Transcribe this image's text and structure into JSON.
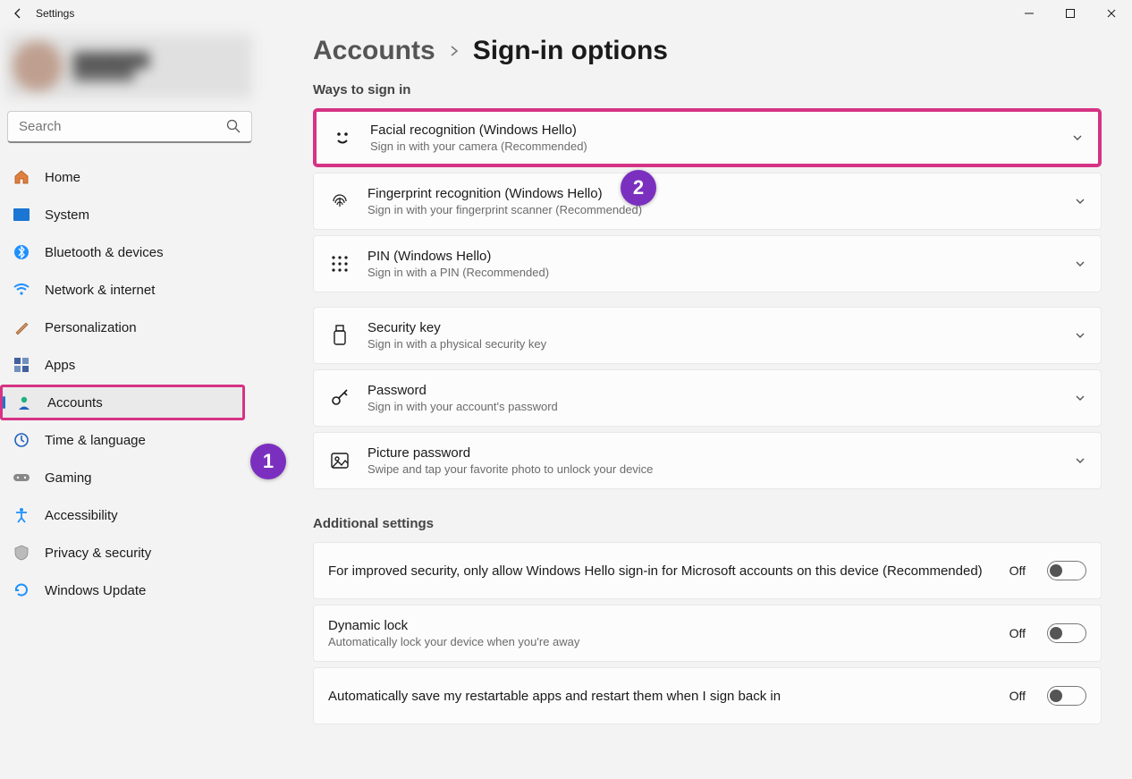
{
  "window": {
    "title": "Settings"
  },
  "search": {
    "placeholder": "Search"
  },
  "sidebar": {
    "items": [
      {
        "label": "Home",
        "icon": "home-icon"
      },
      {
        "label": "System",
        "icon": "system-icon"
      },
      {
        "label": "Bluetooth & devices",
        "icon": "bluetooth-icon"
      },
      {
        "label": "Network & internet",
        "icon": "wifi-icon"
      },
      {
        "label": "Personalization",
        "icon": "brush-icon"
      },
      {
        "label": "Apps",
        "icon": "apps-icon"
      },
      {
        "label": "Accounts",
        "icon": "person-icon"
      },
      {
        "label": "Time & language",
        "icon": "globe-clock-icon"
      },
      {
        "label": "Gaming",
        "icon": "gamepad-icon"
      },
      {
        "label": "Accessibility",
        "icon": "accessibility-icon"
      },
      {
        "label": "Privacy & security",
        "icon": "shield-icon"
      },
      {
        "label": "Windows Update",
        "icon": "update-icon"
      }
    ]
  },
  "breadcrumb": {
    "parent": "Accounts",
    "current": "Sign-in options"
  },
  "sections": {
    "ways": {
      "title": "Ways to sign in",
      "cards": [
        {
          "title": "Facial recognition (Windows Hello)",
          "desc": "Sign in with your camera (Recommended)"
        },
        {
          "title": "Fingerprint recognition (Windows Hello)",
          "desc": "Sign in with your fingerprint scanner (Recommended)"
        },
        {
          "title": "PIN (Windows Hello)",
          "desc": "Sign in with a PIN (Recommended)"
        },
        {
          "title": "Security key",
          "desc": "Sign in with a physical security key"
        },
        {
          "title": "Password",
          "desc": "Sign in with your account's password"
        },
        {
          "title": "Picture password",
          "desc": "Swipe and tap your favorite photo to unlock your device"
        }
      ]
    },
    "additional": {
      "title": "Additional settings",
      "rows": [
        {
          "title": "For improved security, only allow Windows Hello sign-in for Microsoft accounts on this device (Recommended)",
          "desc": "",
          "state": "Off"
        },
        {
          "title": "Dynamic lock",
          "desc": "Automatically lock your device when you're away",
          "state": "Off"
        },
        {
          "title": "Automatically save my restartable apps and restart them when I sign back in",
          "desc": "",
          "state": "Off"
        }
      ]
    }
  },
  "annotations": {
    "callout1": "1",
    "callout2": "2"
  }
}
